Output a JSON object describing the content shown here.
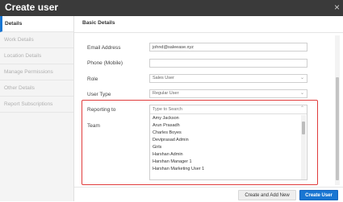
{
  "dialog": {
    "title": "Create user",
    "close_glyph": "×"
  },
  "sidebar": {
    "items": [
      {
        "label": "Details"
      },
      {
        "label": "Work Details"
      },
      {
        "label": "Location Details"
      },
      {
        "label": "Manage Permissions"
      },
      {
        "label": "Other Details"
      },
      {
        "label": "Report Subscriptions"
      }
    ]
  },
  "main": {
    "section_title": "Basic Details",
    "fields": {
      "email": {
        "label": "Email Address",
        "value": "johnd@saleease.xyz"
      },
      "phone": {
        "label": "Phone (Mobile)",
        "value": ""
      },
      "role": {
        "label": "Role",
        "value": "Sales User"
      },
      "user_type": {
        "label": "User Type",
        "value": "Regular User"
      },
      "reporting_to": {
        "label": "Reporting to",
        "placeholder": "Type to Search"
      },
      "team": {
        "label": "Team"
      }
    },
    "reporting_options": [
      "Amy Jackson",
      "Arun Prasadh",
      "Charles Boyes",
      "Deviprasad Admin",
      "Girls",
      "Harshan Admin",
      "Harshan Manager 1",
      "Harshan Marketing User 1"
    ]
  },
  "footer": {
    "create_and_add_new": "Create and Add New",
    "create_user": "Create User"
  },
  "colors": {
    "accent": "#1976d2",
    "highlight": "#e03c3c",
    "titlebar": "#3a3a3a"
  },
  "icons": {
    "close": "close-icon",
    "chevron": "chevron-down-icon"
  }
}
